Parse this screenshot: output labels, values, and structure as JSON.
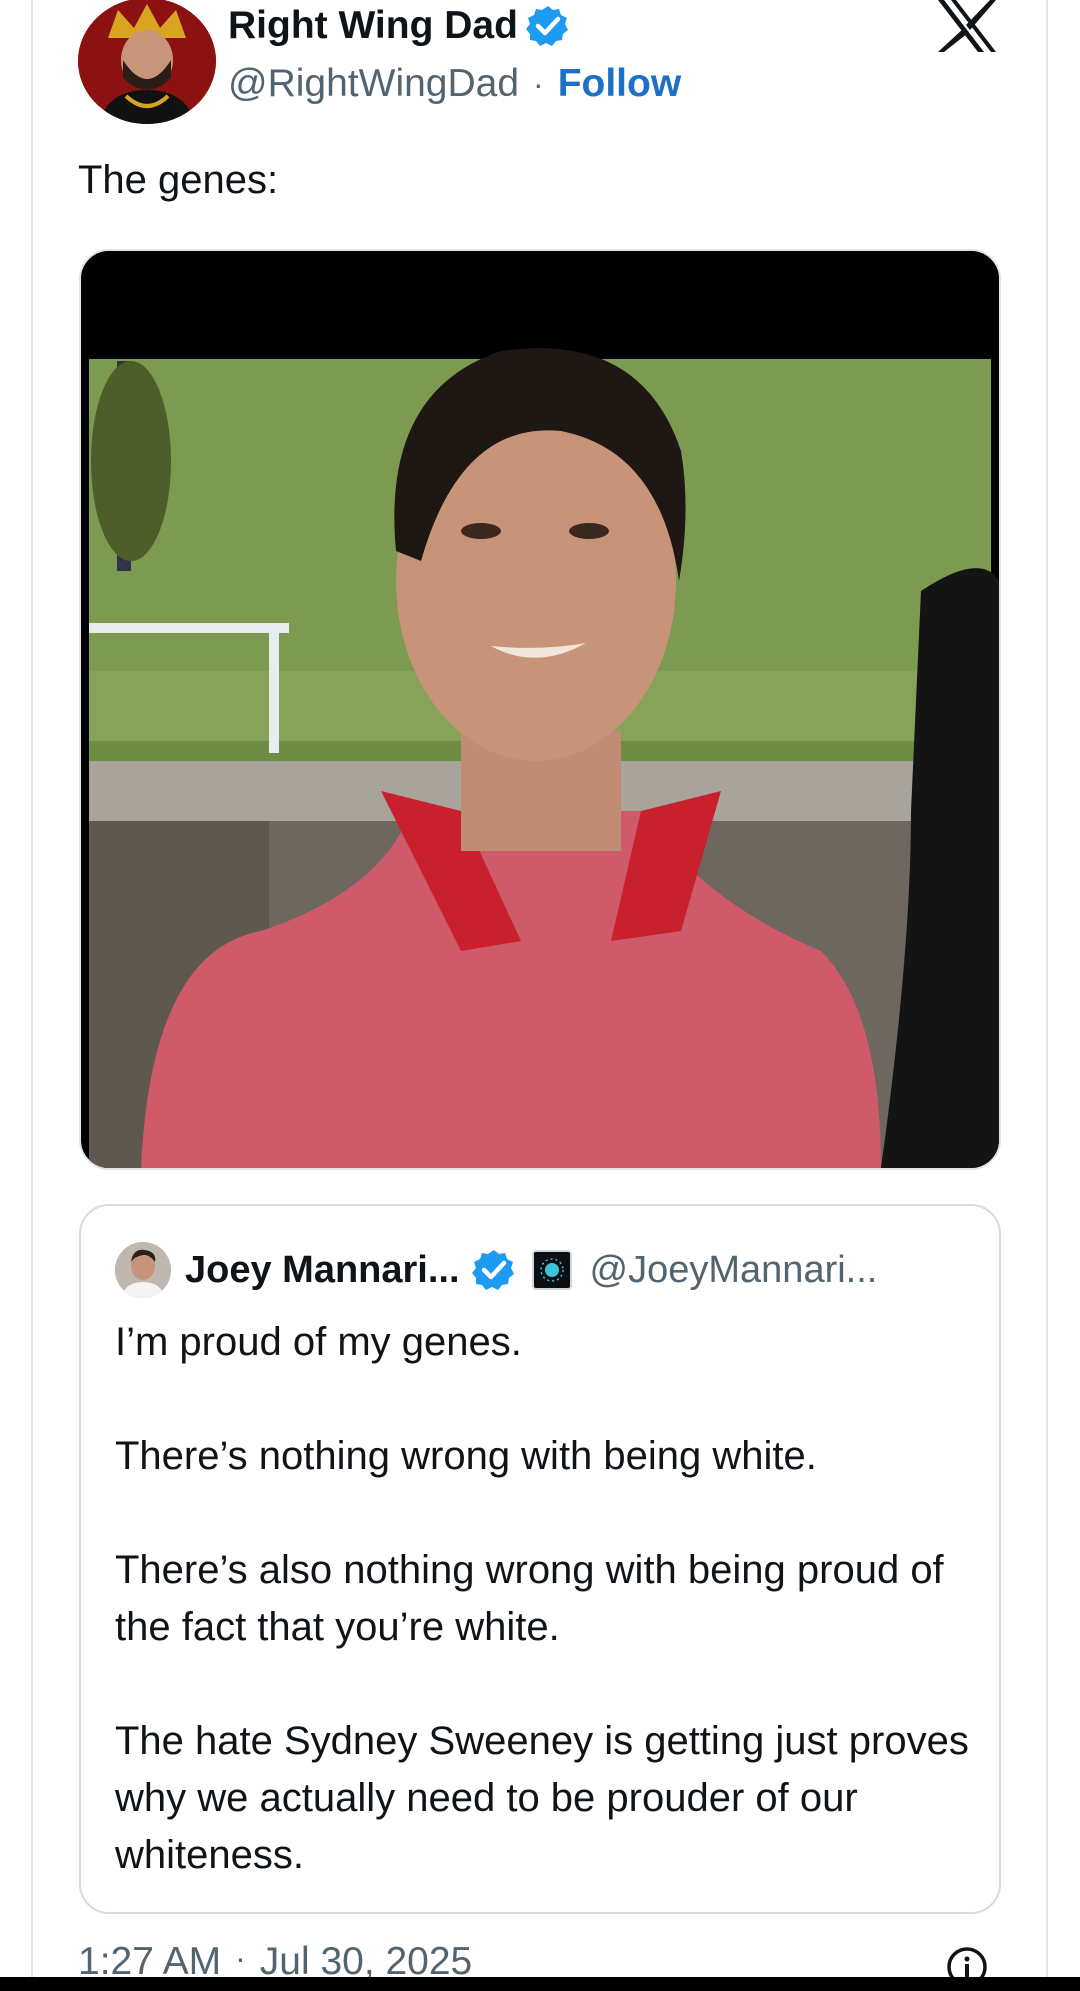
{
  "tweet": {
    "author_name": "Right Wing Dad",
    "author_handle": "@RightWingDad",
    "separator": "·",
    "follow_label": "Follow",
    "text": "The genes:",
    "timestamp_time": "1:27 AM",
    "timestamp_date": "Jul 30, 2025"
  },
  "quote": {
    "author_name": "Joey Mannari...",
    "author_handle": "@JoeyMannari...",
    "paragraphs": [
      "I’m proud of my genes.",
      "There’s nothing wrong with being white.",
      "There’s also nothing wrong with being proud of the fact that you’re white.",
      "The hate Sydney Sweeney is getting just proves why we actually need to be prouder of our whiteness."
    ]
  },
  "icons": {
    "verified": "verified-badge-icon",
    "x_logo": "x-logo-icon",
    "info": "info-icon",
    "affiliate": "affiliate-badge-icon"
  },
  "colors": {
    "follow": "#1d70c8",
    "verified": "#1d9bf0",
    "secondary_text": "#536471",
    "border": "#dfe4e8"
  }
}
